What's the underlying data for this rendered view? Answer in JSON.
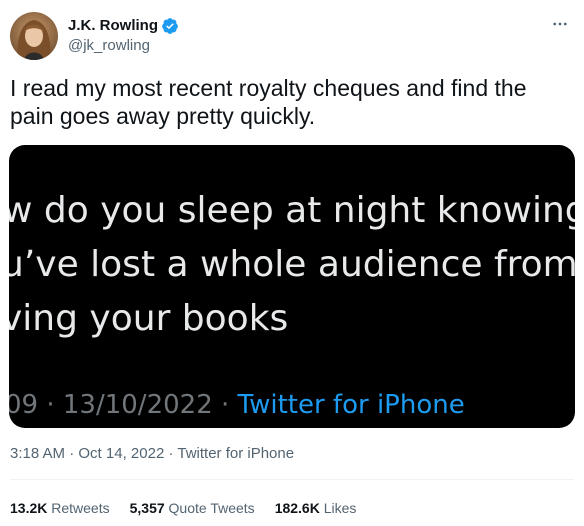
{
  "author": {
    "name": "J.K. Rowling",
    "handle": "@jk_rowling",
    "verified": true
  },
  "tweet": {
    "text": "I read my most recent royalty cheques and find the pain goes away pretty quickly."
  },
  "media": {
    "lines": [
      "w do you sleep at night knowing",
      "u’ve lost a whole audience from",
      "ving your books"
    ],
    "meta_prefix": "09 · 13/10/2022 · ",
    "meta_source": "Twitter for iPhone"
  },
  "meta": {
    "time": "3:18 AM",
    "separator1": " · ",
    "date": "Oct 14, 2022",
    "separator2": " · ",
    "source": "Twitter for iPhone"
  },
  "stats": {
    "retweets_count": "13.2K",
    "retweets_label": "Retweets",
    "quotes_count": "5,357",
    "quotes_label": "Quote Tweets",
    "likes_count": "182.6K",
    "likes_label": "Likes"
  },
  "colors": {
    "verified": "#1d9bf0",
    "link": "#1d9bf0",
    "secondary_text": "#536471",
    "media_bg": "#000000"
  },
  "icons": {
    "verified": "verified-badge-icon",
    "more": "more-horizontal-icon"
  }
}
